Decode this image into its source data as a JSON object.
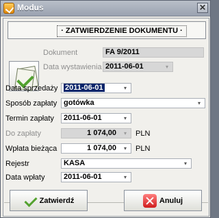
{
  "window": {
    "title": "Modus",
    "close_glyph": "✕",
    "icon": "modus-app-icon"
  },
  "header": {
    "label": "· ZATWIERDZENIE DOKUMENTU ·"
  },
  "document": {
    "icon": "document-check-icon",
    "doc_label": "Dokument",
    "doc_value": "FA 9/2011",
    "issued_label": "Data wystawienia",
    "issued_value": "2011-06-01"
  },
  "form": {
    "sale_date_label": "Data sprzedaży",
    "sale_date_value": "2011-06-01",
    "payment_method_label": "Sposób zapłaty",
    "payment_method_value": "gotówka",
    "payment_term_label": "Termin zapłaty",
    "payment_term_value": "2011-06-01",
    "to_pay_label": "Do zapłaty",
    "to_pay_value": "1 074,00",
    "to_pay_currency": "PLN",
    "current_payment_label": "Wpłata bieżąca",
    "current_payment_value": "1 074,00",
    "current_payment_currency": "PLN",
    "register_label": "Rejestr",
    "register_value": "KASA",
    "payment_date_label": "Data wpłaty",
    "payment_date_value": "2011-06-01"
  },
  "buttons": {
    "confirm_label": "Zatwierdź",
    "cancel_label": "Anuluj"
  },
  "dropdown_glyph": "▾"
}
